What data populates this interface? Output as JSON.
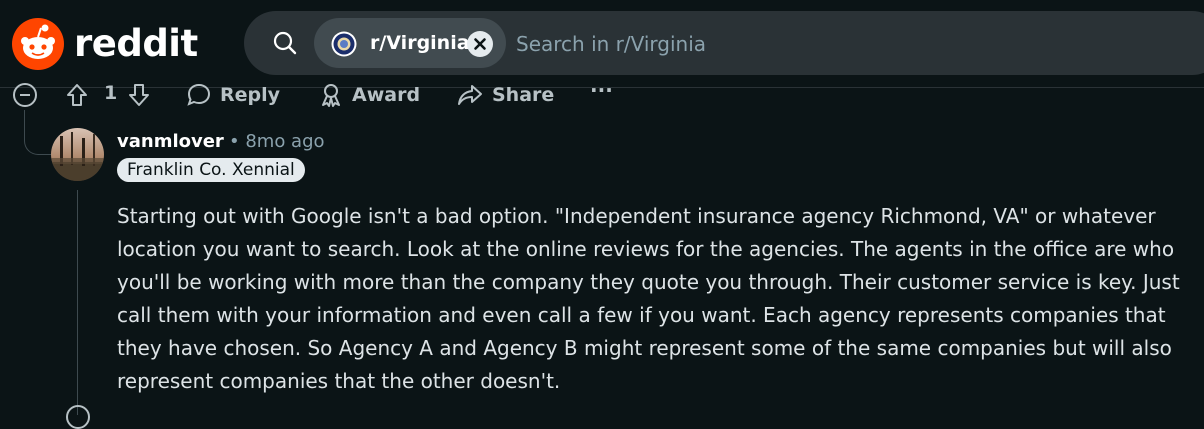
{
  "header": {
    "logo_text": "reddit",
    "search": {
      "chip_label": "r/Virginia",
      "placeholder": "Search in r/Virginia",
      "value": ""
    }
  },
  "parent_actions": {
    "vote_count": "1",
    "reply_label": "Reply",
    "award_label": "Award",
    "share_label": "Share",
    "more_label": "···"
  },
  "comment": {
    "author": "vanmlover",
    "time": "• 8mo ago",
    "flair": "Franklin Co. Xennial",
    "body": "Starting out with Google isn't a bad option. \"Independent insurance agency Richmond, VA\" or whatever location you want to search. Look at the online reviews for the agencies. The agents in the office are who you'll be working with more than the company they quote you through. Their customer service is key. Just call them with your information and even call a few if you want. Each agency represents companies that they have chosen. So Agency A and Agency B might represent some of the same companies but will also represent companies that the other doesn't."
  },
  "colors": {
    "background": "#0b1416",
    "brand": "#ff4500",
    "search_bg": "#2a3236",
    "chip_bg": "#414b50",
    "muted_text": "#8ba2ad"
  }
}
